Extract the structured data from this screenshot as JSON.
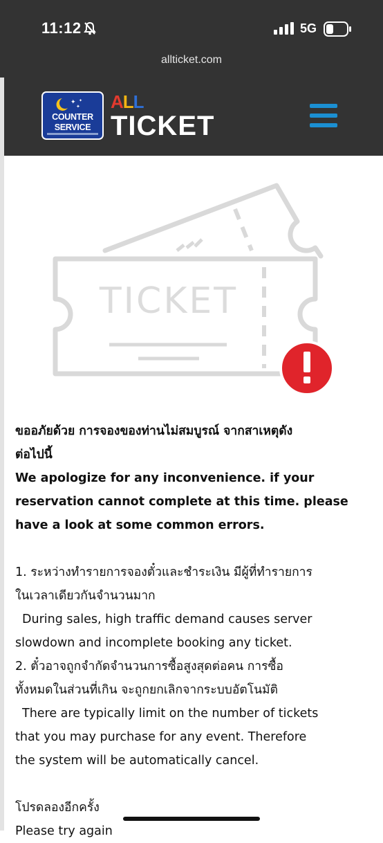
{
  "status_bar": {
    "time": "11:12",
    "network": "5G"
  },
  "browser": {
    "url": "allticket.com"
  },
  "header": {
    "logo_line1": "COUNTER",
    "logo_line2": "SERVICE",
    "brand_top": "ALL",
    "brand_bottom": "TICKET",
    "menu_icon": "hamburger-menu-icon"
  },
  "illustration": {
    "ticket_label": "TICKET",
    "alert_symbol": "!"
  },
  "colors": {
    "header_bg": "#333333",
    "alert_red": "#e0242b",
    "menu_blue": "#1b8fd2",
    "logo_blue": "#1a3c98"
  },
  "message": {
    "title_th_1": "ขออภัยด้วย การจองของท่านไม่สมบูรณ์ จากสาเหตุดัง",
    "title_th_2": "ต่อไปนี้",
    "title_en_1": "We apologize for any inconvenience. if your",
    "title_en_2": "reservation cannot complete at this time. please",
    "title_en_3": "have a look at some common errors.",
    "item1_th_1": "1. ระหว่างทำรายการจองตั๋วและชำระเงิน มีผู้ที่ทำรายการ",
    "item1_th_2": "ในเวลาเดียวกันจำนวนมาก",
    "item1_en_1": "During sales, high traffic demand causes server",
    "item1_en_2": "slowdown and incomplete booking any ticket.",
    "item2_th_1": "2. ตั๋วอาจถูกจำกัดจำนวนการซื้อสูงสุดต่อคน การซื้อ",
    "item2_th_2": "ทั้งหมดในส่วนที่เกิน จะถูกยกเลิกจากระบบอัตโนมัติ",
    "item2_en_1": "There are typically limit on the number of tickets",
    "item2_en_2": "that you may purchase for any event. Therefore",
    "item2_en_3": "the system will be automatically cancel.",
    "retry_th": "โปรดลองอีกครั้ง",
    "retry_en": "Please try again"
  }
}
